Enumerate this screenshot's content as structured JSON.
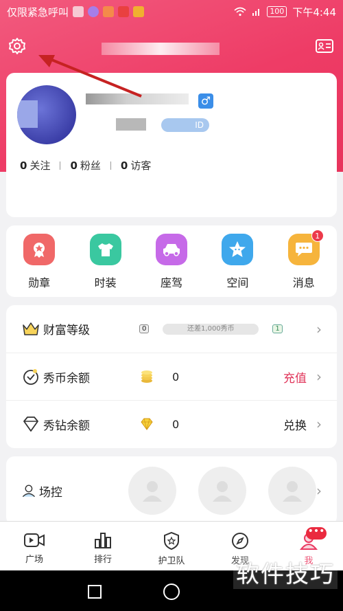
{
  "status_bar": {
    "carrier_text": "仅限紧急呼叫",
    "battery": "100",
    "time": "下午4:44"
  },
  "profile": {
    "id_badge": "ID",
    "stats": [
      {
        "value": "0",
        "label": "关注"
      },
      {
        "value": "0",
        "label": "粉丝"
      },
      {
        "value": "0",
        "label": "访客"
      }
    ]
  },
  "features": [
    {
      "label": "勋章",
      "color": "#f06868"
    },
    {
      "label": "时装",
      "color": "#3ac8a0"
    },
    {
      "label": "座驾",
      "color": "#c66ae8"
    },
    {
      "label": "空间",
      "color": "#3fa8ec"
    },
    {
      "label": "消息",
      "color": "#f6b43c",
      "badge": "1"
    }
  ],
  "wealth": {
    "level_row": {
      "label": "财富等级",
      "current_level": "0",
      "progress_text": "还差1,000秀币",
      "next_level": "1"
    },
    "coin_row": {
      "label": "秀币余额",
      "value": "0",
      "action": "充值"
    },
    "diamond_row": {
      "label": "秀钻余额",
      "value": "0",
      "action": "兑换"
    }
  },
  "control": {
    "label": "场控"
  },
  "navbar": [
    {
      "label": "广场",
      "icon": "video-icon"
    },
    {
      "label": "排行",
      "icon": "chart-icon"
    },
    {
      "label": "护卫队",
      "icon": "shield-icon"
    },
    {
      "label": "发现",
      "icon": "compass-icon"
    },
    {
      "label": "我",
      "icon": "user-icon",
      "dot": "•••"
    }
  ],
  "watermark": "软件技巧",
  "colors": {
    "header_pink": "#ee3c66",
    "accent_red": "#e0355a"
  }
}
